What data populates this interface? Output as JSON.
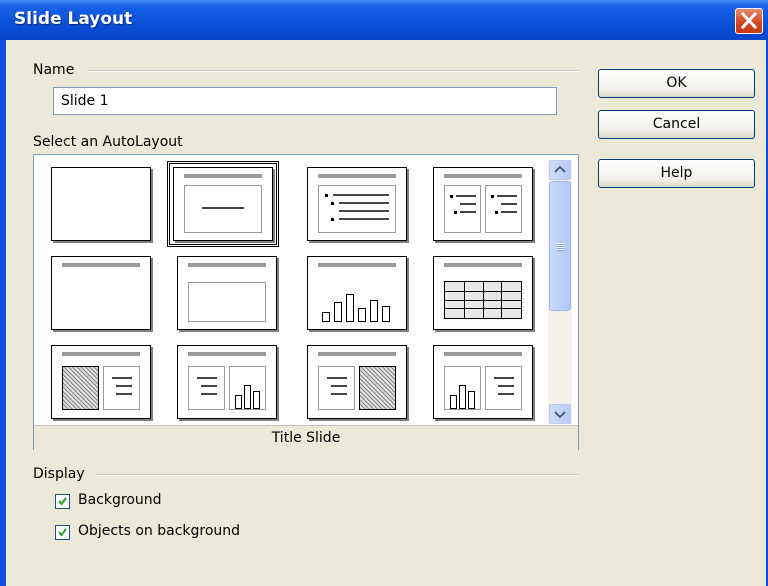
{
  "window": {
    "title": "Slide Layout"
  },
  "name_section": {
    "label": "Name",
    "value": "Slide 1"
  },
  "autolayout": {
    "label": "Select an AutoLayout",
    "selected_caption": "Title Slide",
    "layouts": [
      "Blank Slide",
      "Title Slide",
      "Title, Content",
      "Title and 2 Content",
      "Title Only",
      "Centered Text",
      "Title, Chart",
      "Title, Spreadsheet",
      "Title, Clipart and Text",
      "Title, Text and Chart",
      "Title, Text and Clipart",
      "Title, Chart and Text"
    ]
  },
  "buttons": {
    "ok": "OK",
    "cancel": "Cancel",
    "help": "Help"
  },
  "display": {
    "label": "Display",
    "background": {
      "label": "Background",
      "checked": true
    },
    "objects": {
      "label": "Objects on background",
      "checked": true
    }
  },
  "icons": {
    "close": "close-icon",
    "up": "scroll-up-arrow-icon",
    "down": "scroll-down-arrow-icon",
    "check": "checkmark-icon"
  },
  "colors": {
    "titlebar": "#0a4fd8",
    "dialog": "#ece9d8",
    "close": "#d4461e",
    "check": "#21a121"
  }
}
